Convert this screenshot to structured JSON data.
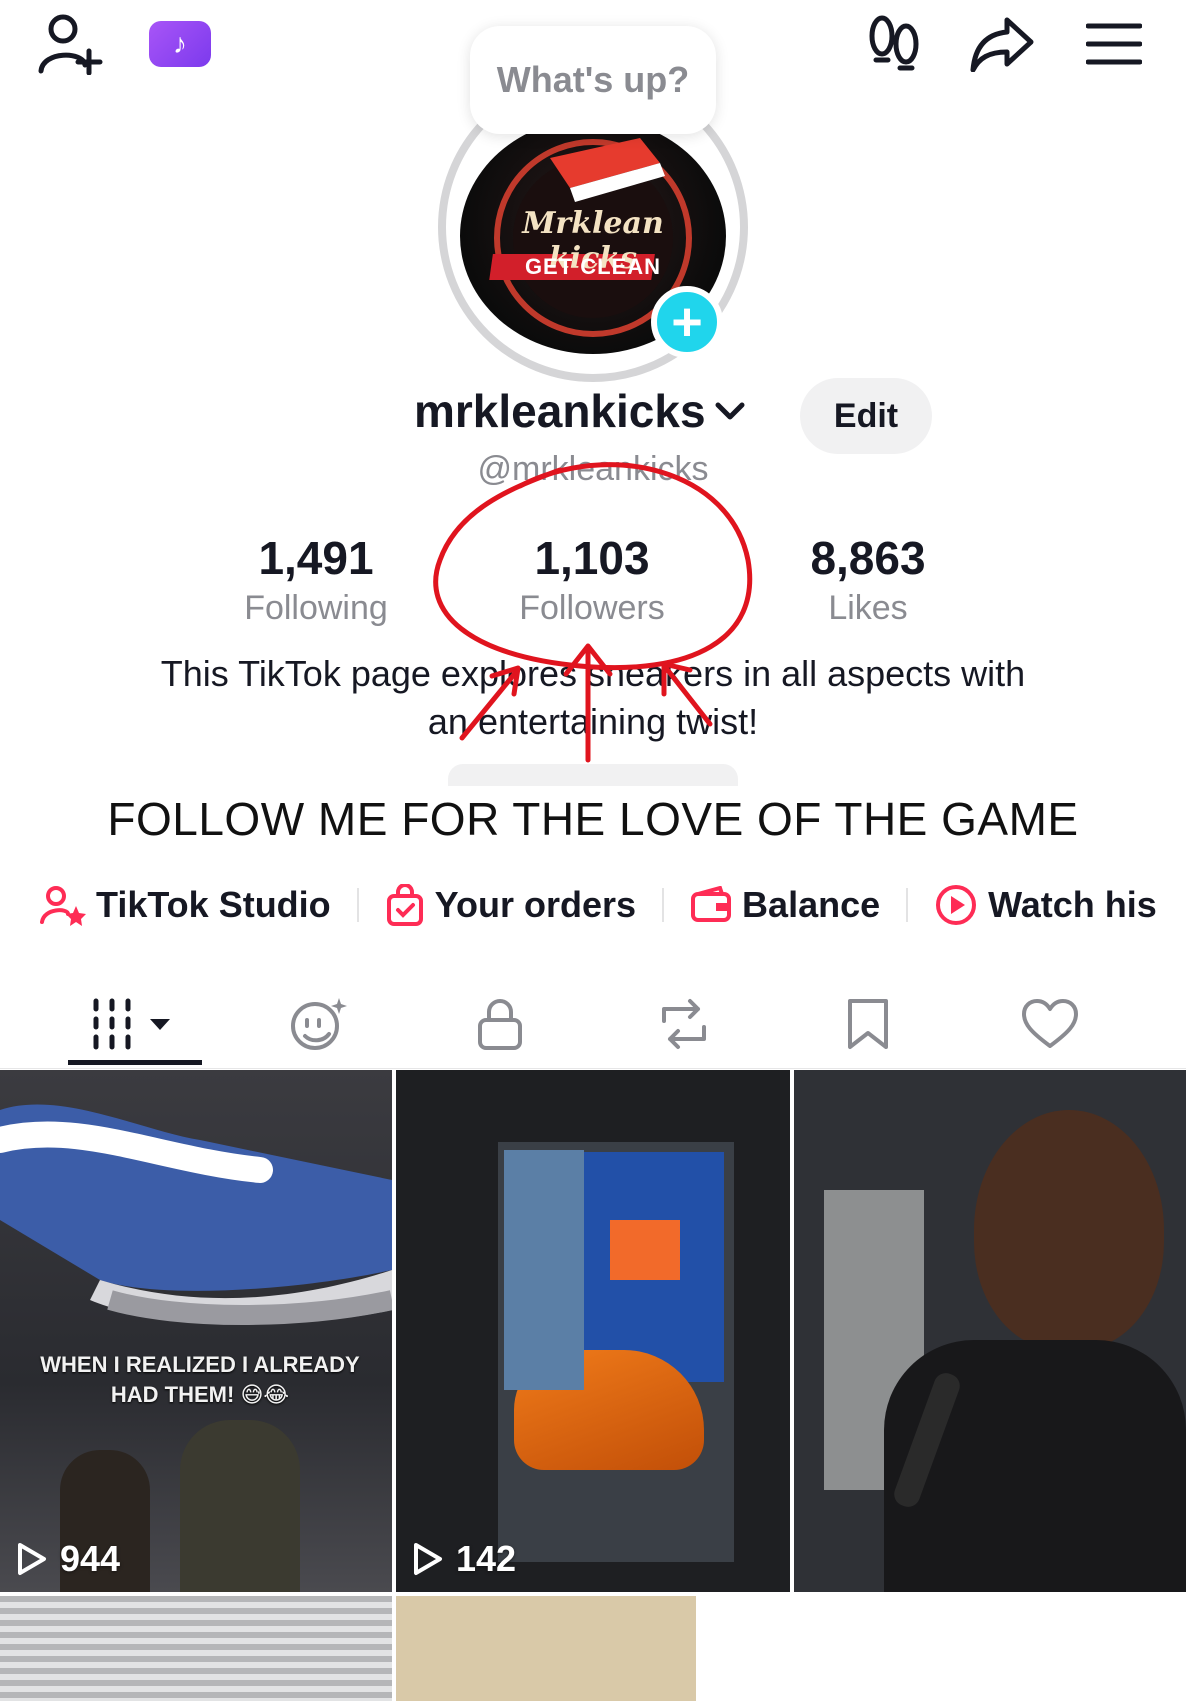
{
  "header": {
    "bubble_text": "What's up?",
    "icons": [
      "add-friend-icon",
      "tiktok-badge-icon",
      "footprints-icon",
      "share-icon",
      "menu-icon"
    ]
  },
  "profile": {
    "avatar_text_top": "Mrklean kicks",
    "avatar_text_banner": "GET CLEAN",
    "username": "mrkleankicks",
    "handle": "@mrkleankicks",
    "edit_label": "Edit",
    "stats": [
      {
        "value": "1,491",
        "label": "Following"
      },
      {
        "value": "1,103",
        "label": "Followers"
      },
      {
        "value": "8,863",
        "label": "Likes"
      }
    ],
    "bio_line1": "This TikTok page explores sneakers in all aspects with",
    "bio_line2": "an entertaining twist!"
  },
  "overlay": {
    "banner_text": "FOLLOW ME FOR THE LOVE OF THE GAME",
    "annotation_color": "#e0141e"
  },
  "shortcuts": [
    {
      "label": "TikTok Studio",
      "icon": "studio-icon"
    },
    {
      "label": "Your orders",
      "icon": "orders-bag-icon"
    },
    {
      "label": "Balance",
      "icon": "wallet-icon"
    },
    {
      "label": "Watch his",
      "icon": "play-history-icon"
    }
  ],
  "tabs": [
    "videos-grid-icon",
    "reposts-face-icon",
    "lock-icon",
    "repost-icon",
    "bookmark-icon",
    "heart-icon"
  ],
  "videos": [
    {
      "views": "944",
      "caption": "WHEN I REALIZED I ALREADY HAD THEM! 😅😂"
    },
    {
      "views": "142",
      "caption": ""
    },
    {
      "views": "",
      "caption": ""
    }
  ],
  "colors": {
    "accent": "#fe2c55",
    "brand_cyan": "#20d5ec",
    "text": "#161823",
    "muted": "#8a8b91",
    "tiktok_badge": "#8b5cf6"
  }
}
